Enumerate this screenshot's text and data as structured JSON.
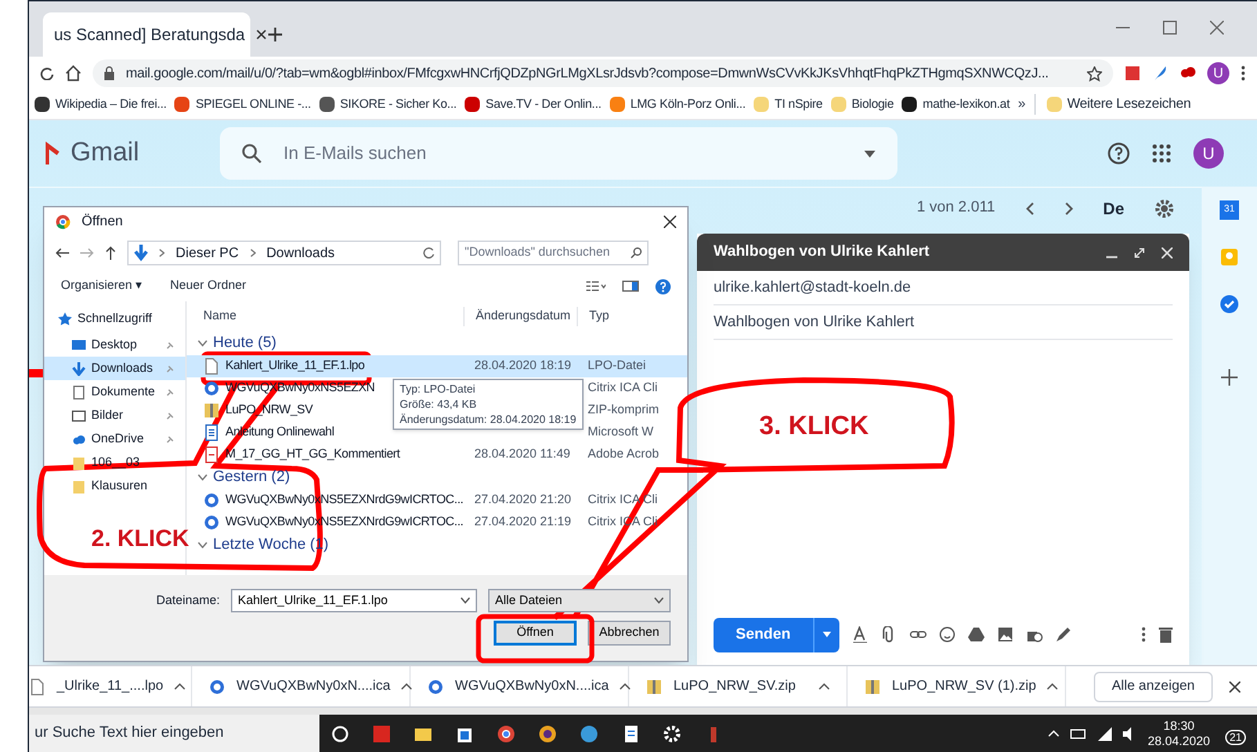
{
  "browser": {
    "tab_title": "us Scanned] Beratungsda",
    "url": "mail.google.com/mail/u/0/?tab=wm&ogbl#inbox/FMfcgxwHNCrfjQDZpNGrLMgXLsrJdsvb?compose=DmwnWsCVvKkJKsVhhqtFhqPkZTHgmqSXNWCQzJ...",
    "avatar": "U",
    "bookmarks": [
      {
        "label": "Wikipedia – Die frei...",
        "color": "#333333"
      },
      {
        "label": "SPIEGEL ONLINE -...",
        "color": "#e64415"
      },
      {
        "label": "SIKORE - Sicher Ko...",
        "color": "#555555"
      },
      {
        "label": "Save.TV - Der Onlin...",
        "color": "#cc0000"
      },
      {
        "label": "LMG Köln-Porz Onli...",
        "color": "#f98012"
      },
      {
        "label": "TI nSpire",
        "color": "#f5d67a"
      },
      {
        "label": "Biologie",
        "color": "#f5d67a"
      },
      {
        "label": "mathe-lexikon.at",
        "color": "#1a1a1a"
      }
    ],
    "more": "»",
    "more_bookmarks": "Weitere Lesezeichen"
  },
  "gmail": {
    "logo": "Gmail",
    "search_placeholder": "In E-Mails suchen",
    "pager": "1 von 2.011",
    "lang": "De",
    "avatar": "U",
    "calendar_day": "31"
  },
  "dialog": {
    "title": "Öffnen",
    "path": [
      "Dieser PC",
      "Downloads"
    ],
    "search_placeholder": "\"Downloads\" durchsuchen",
    "organize": "Organisieren ▾",
    "new_folder": "Neuer Ordner",
    "sidebar": [
      {
        "label": "Schnellzugriff",
        "kind": "star",
        "selected": false
      },
      {
        "label": "Desktop",
        "kind": "desktop",
        "selected": false
      },
      {
        "label": "Downloads",
        "kind": "download",
        "selected": true
      },
      {
        "label": "Dokumente",
        "kind": "doc",
        "selected": false
      },
      {
        "label": "Bilder",
        "kind": "image",
        "selected": false
      },
      {
        "label": "OneDrive",
        "kind": "cloud",
        "selected": false
      },
      {
        "label": "106__03",
        "kind": "folder",
        "selected": false
      },
      {
        "label": "Klausuren",
        "kind": "folder",
        "selected": false
      }
    ],
    "columns": [
      "Name",
      "Änderungsdatum",
      "Typ"
    ],
    "groups": [
      {
        "label": "Heute (5)",
        "files": [
          {
            "name": "Kahlert_Ulrike_11_EF.1.lpo",
            "date": "28.04.2020 18:19",
            "type": "LPO-Datei",
            "kind": "file",
            "selected": true
          },
          {
            "name": "WGVuQXBwNy0xNS5EZXN",
            "type": "Citrix ICA Cli",
            "kind": "ica",
            "selected": false
          },
          {
            "name": "LuPO_NRW_SV",
            "type": "ZIP-komprim",
            "kind": "zip",
            "selected": false
          },
          {
            "name": "Anleitung Onlinewahl",
            "type": "Microsoft W",
            "kind": "doc",
            "selected": false
          },
          {
            "name": "M_17_GG_HT_GG_Kommentiert",
            "date": "28.04.2020 11:49",
            "type": "Adobe Acrob",
            "kind": "pdf",
            "selected": false
          }
        ]
      },
      {
        "label": "Gestern (2)",
        "files": [
          {
            "name": "WGVuQXBwNy0xNS5EZXNrdG9wICRTOC...",
            "date": "27.04.2020 21:20",
            "type": "Citrix ICA Cli",
            "kind": "ica",
            "selected": false
          },
          {
            "name": "WGVuQXBwNy0xNS5EZXNrdG9wICRTOC...",
            "date": "27.04.2020 21:19",
            "type": "Citrix ICA Cli",
            "kind": "ica",
            "selected": false
          }
        ]
      },
      {
        "label": "Letzte Woche (1)"
      }
    ],
    "tooltip": [
      "Typ: LPO-Datei",
      "Größe: 43,4 KB",
      "Änderungsdatum: 28.04.2020 18:19"
    ],
    "filename_label": "Dateiname:",
    "filename": "Kahlert_Ulrike_11_EF.1.lpo",
    "filter": "Alle Dateien",
    "open": "Öffnen",
    "cancel": "Abbrechen"
  },
  "compose": {
    "title": "Wahlbogen von Ulrike Kahlert",
    "to": "ulrike.kahlert@stadt-koeln.de",
    "subject": "Wahlbogen von Ulrike Kahlert",
    "send": "Senden"
  },
  "annotations": [
    {
      "text": "2. KLICK"
    },
    {
      "text": "3. KLICK"
    }
  ],
  "downloads": {
    "items": [
      {
        "name": "_Ulrike_11_....lpo",
        "kind": "file"
      },
      {
        "name": "WGVuQXBwNy0xN....ica",
        "kind": "ica"
      },
      {
        "name": "WGVuQXBwNy0xN....ica",
        "kind": "ica"
      },
      {
        "name": "LuPO_NRW_SV.zip",
        "kind": "zip"
      },
      {
        "name": "LuPO_NRW_SV (1).zip",
        "kind": "zip"
      }
    ],
    "show_all": "Alle anzeigen"
  },
  "taskbar": {
    "search": "ur Suche Text hier eingeben",
    "time": "18:30",
    "date": "28.04.2020",
    "notifications": "21"
  }
}
